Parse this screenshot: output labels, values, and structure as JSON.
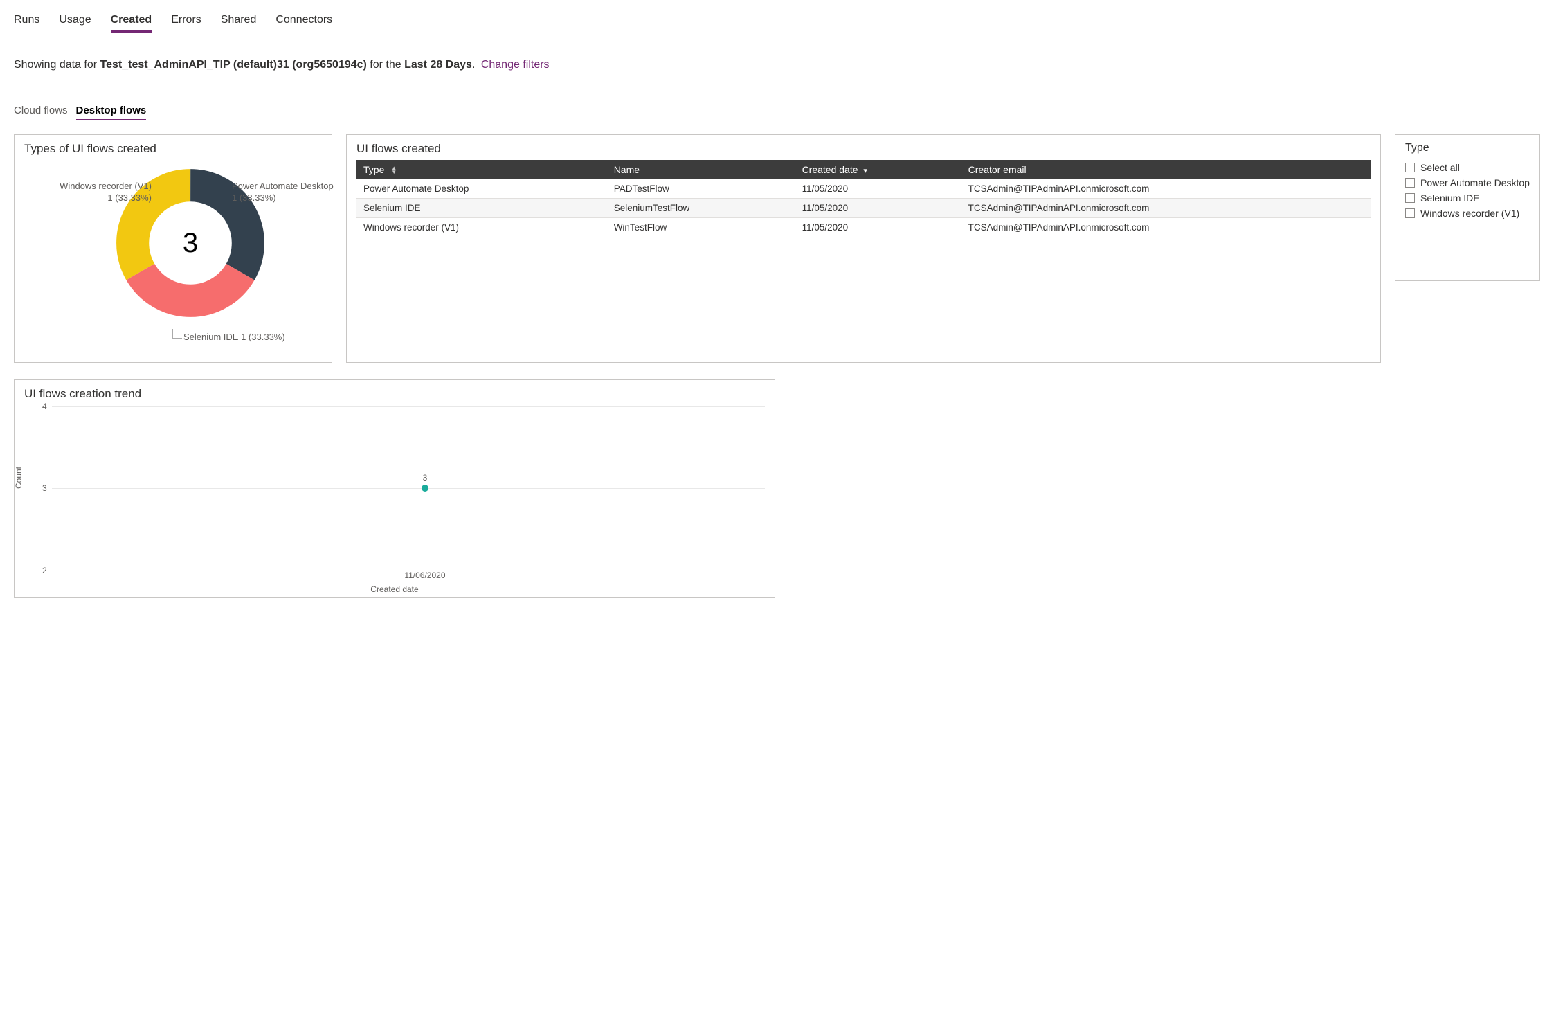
{
  "top_tabs": {
    "runs": "Runs",
    "usage": "Usage",
    "created": "Created",
    "errors": "Errors",
    "shared": "Shared",
    "connectors": "Connectors",
    "active": "created"
  },
  "filter_line": {
    "prefix": "Showing data for ",
    "env": "Test_test_AdminAPI_TIP (default)31 (org5650194c)",
    "mid": " for the ",
    "range": "Last 28 Days",
    "suffix": ". ",
    "change": "Change filters"
  },
  "sub_tabs": {
    "cloud": "Cloud flows",
    "desktop": "Desktop flows",
    "active": "desktop"
  },
  "donut": {
    "title": "Types of UI flows created",
    "center": "3",
    "labels": {
      "wr_line1": "Windows recorder (V1)",
      "wr_line2": "1 (33.33%)",
      "pad_line1": "Power Automate Desktop",
      "pad_line2": "1 (33.33%)",
      "sel": "Selenium IDE 1 (33.33%)"
    }
  },
  "table": {
    "title": "UI flows created",
    "headers": {
      "type": "Type",
      "name": "Name",
      "created": "Created date",
      "email": "Creator email"
    },
    "rows": [
      {
        "type": "Power Automate Desktop",
        "name": "PADTestFlow",
        "created": "11/05/2020",
        "email": "TCSAdmin@TIPAdminAPI.onmicrosoft.com"
      },
      {
        "type": "Selenium IDE",
        "name": "SeleniumTestFlow",
        "created": "11/05/2020",
        "email": "TCSAdmin@TIPAdminAPI.onmicrosoft.com"
      },
      {
        "type": "Windows recorder (V1)",
        "name": "WinTestFlow",
        "created": "11/05/2020",
        "email": "TCSAdmin@TIPAdminAPI.onmicrosoft.com"
      }
    ]
  },
  "filter_panel": {
    "title": "Type",
    "options": [
      "Select all",
      "Power Automate Desktop",
      "Selenium IDE",
      "Windows recorder (V1)"
    ]
  },
  "trend": {
    "title": "UI flows creation trend",
    "ylabel": "Count",
    "xlabel": "Created date",
    "y_ticks": [
      "4",
      "3",
      "2"
    ],
    "x_tick": "11/06/2020",
    "point_label": "3"
  },
  "chart_data": [
    {
      "type": "pie",
      "title": "Types of UI flows created",
      "series": [
        {
          "name": "Windows recorder (V1)",
          "value": 1,
          "percent": 33.33,
          "color": "#f2c811"
        },
        {
          "name": "Power Automate Desktop",
          "value": 1,
          "percent": 33.33,
          "color": "#33414e"
        },
        {
          "name": "Selenium IDE",
          "value": 1,
          "percent": 33.33,
          "color": "#f66d6d"
        }
      ],
      "total": 3
    },
    {
      "type": "line",
      "title": "UI flows creation trend",
      "xlabel": "Created date",
      "ylabel": "Count",
      "ylim": [
        2,
        4
      ],
      "x": [
        "11/06/2020"
      ],
      "series": [
        {
          "name": "Count",
          "values": [
            3
          ],
          "color": "#1aab9b"
        }
      ]
    }
  ]
}
